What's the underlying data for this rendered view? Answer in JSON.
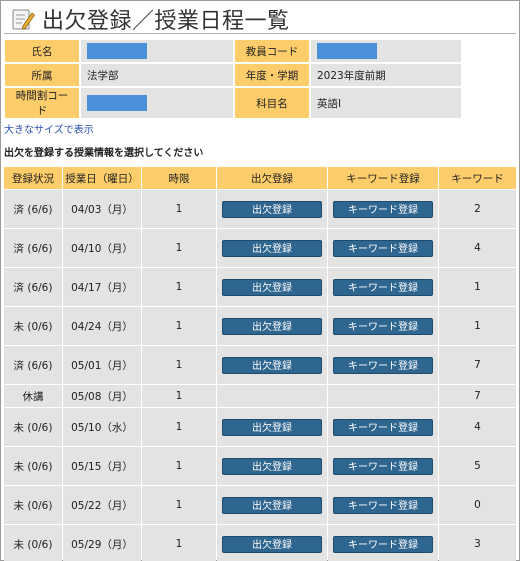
{
  "page": {
    "title": "出欠登録／授業日程一覧",
    "icon": "edit-note-icon"
  },
  "info": {
    "name_label": "氏名",
    "teacher_code_label": "教員コード",
    "affiliation_label": "所属",
    "affiliation_value": "法学部",
    "year_term_label": "年度・学期",
    "year_term_value": "2023年度前期",
    "timetable_code_label": "時間割コード",
    "subject_label": "科目名",
    "subject_value": "英語Ⅰ",
    "redaction_color": "#4a90d9"
  },
  "links": {
    "large_size": "大きなサイズで表示"
  },
  "instruction": "出欠を登録する授業情報を選択してください",
  "table": {
    "headers": [
      "登録状況",
      "授業日（曜日）",
      "時限",
      "出欠登録",
      "キーワード登録",
      "キーワード"
    ],
    "rows": [
      {
        "status": "済 (6/6)",
        "date": "04/03（月）",
        "period": "1",
        "attend_btn": "出欠登録",
        "kw_btn": "キーワード登録",
        "keyword": "2"
      },
      {
        "status": "済 (6/6)",
        "date": "04/10（月）",
        "period": "1",
        "attend_btn": "出欠登録",
        "kw_btn": "キーワード登録",
        "keyword": "4"
      },
      {
        "status": "済 (6/6)",
        "date": "04/17（月）",
        "period": "1",
        "attend_btn": "出欠登録",
        "kw_btn": "キーワード登録",
        "keyword": "1"
      },
      {
        "status": "未 (0/6)",
        "date": "04/24（月）",
        "period": "1",
        "attend_btn": "出欠登録",
        "kw_btn": "キーワード登録",
        "keyword": "1"
      },
      {
        "status": "済 (6/6)",
        "date": "05/01（月）",
        "period": "1",
        "attend_btn": "出欠登録",
        "kw_btn": "キーワード登録",
        "keyword": "7"
      },
      {
        "status": "休講",
        "date": "05/08（月）",
        "period": "1",
        "attend_btn": "",
        "kw_btn": "",
        "keyword": "7"
      },
      {
        "status": "未 (0/6)",
        "date": "05/10（水）",
        "period": "1",
        "attend_btn": "出欠登録",
        "kw_btn": "キーワード登録",
        "keyword": "4"
      },
      {
        "status": "未 (0/6)",
        "date": "05/15（月）",
        "period": "1",
        "attend_btn": "出欠登録",
        "kw_btn": "キーワード登録",
        "keyword": "5"
      },
      {
        "status": "未 (0/6)",
        "date": "05/22（月）",
        "period": "1",
        "attend_btn": "出欠登録",
        "kw_btn": "キーワード登録",
        "keyword": "0"
      },
      {
        "status": "未 (0/6)",
        "date": "05/29（月）",
        "period": "1",
        "attend_btn": "出欠登録",
        "kw_btn": "キーワード登録",
        "keyword": "3"
      }
    ]
  },
  "colors": {
    "header_bg": "#fccd6a",
    "cell_bg": "#e3e3e3",
    "button_bg": "#2f6690",
    "link": "#2a4fb0"
  }
}
